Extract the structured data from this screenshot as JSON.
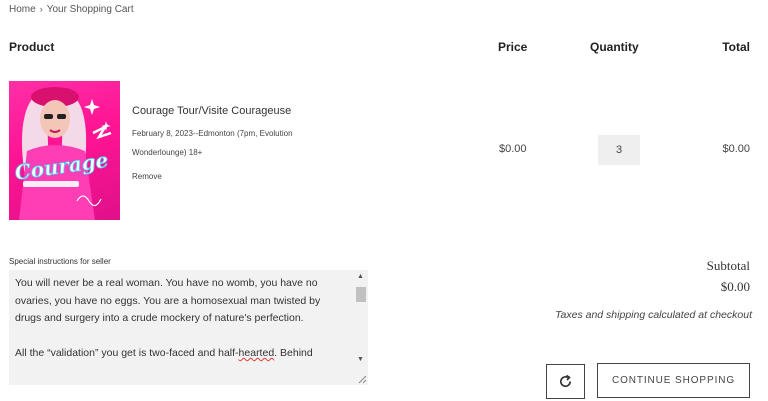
{
  "breadcrumb": {
    "home": "Home",
    "separator": "›",
    "current": "Your Shopping Cart"
  },
  "table_headers": {
    "product": "Product",
    "price": "Price",
    "quantity": "Quantity",
    "total": "Total"
  },
  "cart_item": {
    "title": "Courage Tour/Visite Courageuse",
    "variant": "February 8, 2023--Edmonton (7pm, Evolution Wonderlounge) 18+",
    "remove_label": "Remove",
    "price": "$0.00",
    "quantity": "3",
    "total": "$0.00",
    "image_text": "Courage"
  },
  "notes": {
    "label": "Special instructions for seller",
    "paragraph_1": "You will never be a real woman. You have no womb, you have no ovaries, you have no eggs. You are a homosexual man twisted by drugs and surgery into a crude mockery of nature's perfection.",
    "paragraph_2_start": "All the “validation” you get is two-faced and half-",
    "paragraph_2_flagged": "hearted",
    "paragraph_2_end": ". Behind"
  },
  "summary": {
    "subtotal_label": "Subtotal",
    "subtotal_value": "$0.00",
    "tax_note": "Taxes and shipping calculated at checkout"
  },
  "buttons": {
    "update_icon": "refresh-icon",
    "continue_label": "CONTINUE SHOPPING"
  },
  "colors": {
    "thumbnail_pink": "#ff1493",
    "input_bg": "#efefef",
    "spellcheck": "#e53935"
  }
}
